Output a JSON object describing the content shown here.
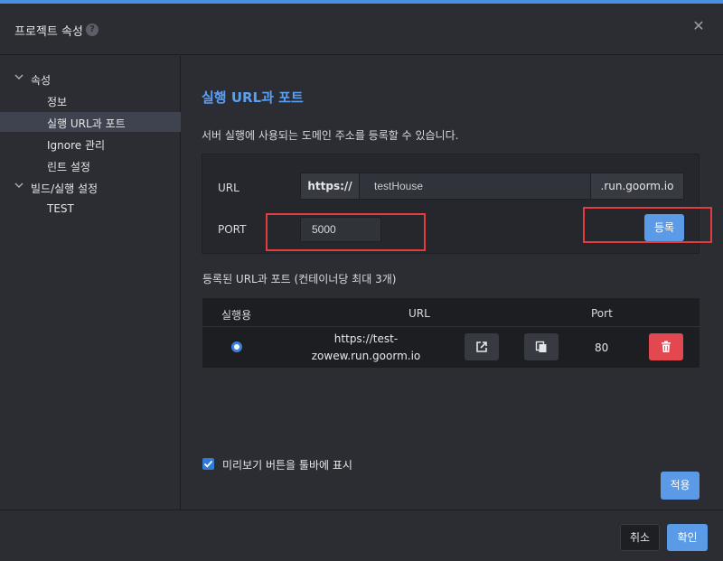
{
  "dialog": {
    "title": "프로젝트 속성",
    "help_icon": "?",
    "close_icon": "✕"
  },
  "sidebar": {
    "groups": [
      {
        "label": "속성",
        "items": [
          "정보",
          "실행 URL과 포트",
          "Ignore 관리",
          "린트 설정"
        ]
      },
      {
        "label": "빌드/실행 설정",
        "items": [
          "TEST"
        ]
      }
    ],
    "active_item": "실행 URL과 포트"
  },
  "main": {
    "title": "실행 URL과 포트",
    "description": "서버 실행에 사용되는 도메인 주소를 등록할 수 있습니다.",
    "url_label": "URL",
    "url_prefix": "https://",
    "url_value": "testHouse",
    "url_suffix": ".run.goorm.io",
    "port_label": "PORT",
    "port_value": "5000",
    "register_label": "등록",
    "list_title": "등록된 URL과 포트 (컨테이너당 최대 3개)",
    "table": {
      "headers": [
        "실행용",
        "URL",
        "Port"
      ],
      "rows": [
        {
          "selected": true,
          "url_line1": "https://test-",
          "url_line2": "zowew.run.goorm.io",
          "port": "80"
        }
      ]
    },
    "preview_checkbox": {
      "checked": true,
      "label": "미리보기 버튼을 툴바에 표시"
    },
    "apply_label": "적용"
  },
  "footer": {
    "cancel_label": "취소",
    "confirm_label": "확인"
  },
  "colors": {
    "accent": "#5b9ae6",
    "danger": "#e34850",
    "annotation": "#e23c3c"
  }
}
